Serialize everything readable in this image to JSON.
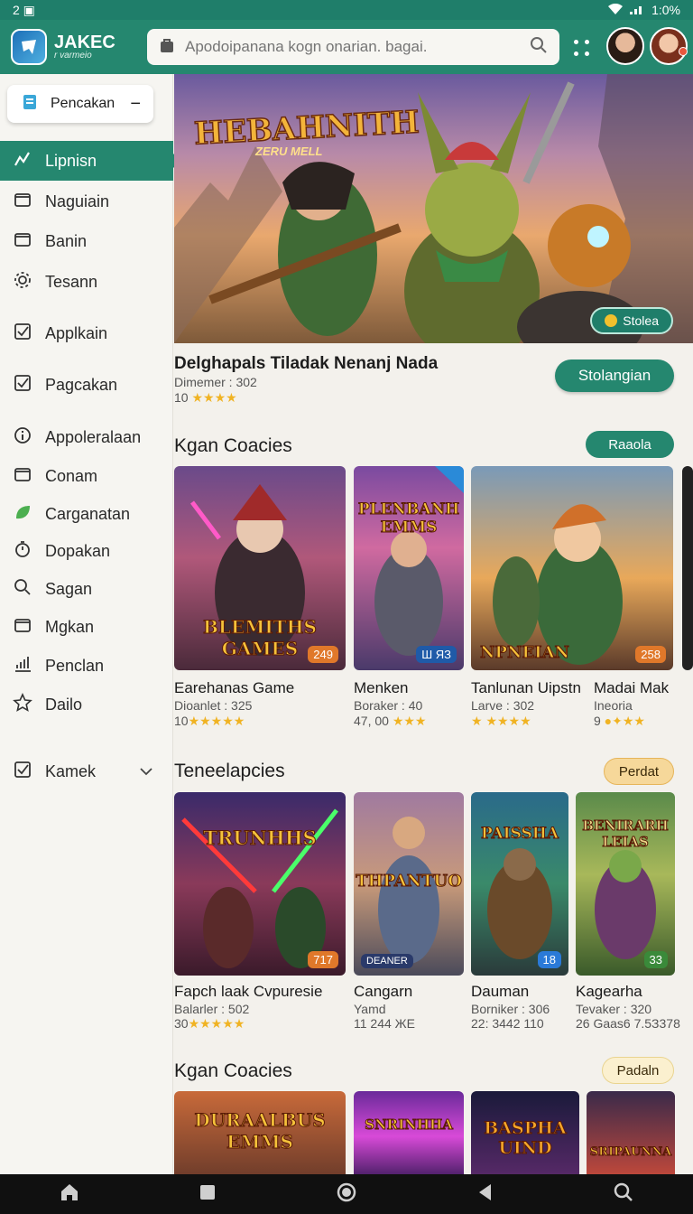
{
  "status": {
    "left": "2 ▣",
    "right": "1:0%"
  },
  "app": {
    "logo_title": "JAKEC",
    "logo_sub": "r varmeio"
  },
  "search": {
    "placeholder": "Apodoipanana kogn onarian. bagai."
  },
  "sidebar": {
    "top_button": "Pencakan",
    "items": [
      {
        "label": "Lipnisn",
        "icon": "chart-icon",
        "active": true
      },
      {
        "label": "Naguiain",
        "icon": "folder-icon"
      },
      {
        "label": "Banin",
        "icon": "folder-icon"
      },
      {
        "label": "Tesann",
        "icon": "gear-icon"
      },
      {
        "label": "Applkain",
        "icon": "check-icon"
      },
      {
        "label": "Pagcakan",
        "icon": "check-icon"
      },
      {
        "label": "Appoleralaan",
        "icon": "info-icon"
      },
      {
        "label": "Conam",
        "icon": "folder-icon"
      },
      {
        "label": "Carganatan",
        "icon": "leaf-icon"
      },
      {
        "label": "Dopakan",
        "icon": "timer-icon"
      },
      {
        "label": "Sagan",
        "icon": "search-icon"
      },
      {
        "label": "Mgkan",
        "icon": "folder-icon"
      },
      {
        "label": "Penclan",
        "icon": "bar-chart-icon"
      },
      {
        "label": "Dailo",
        "icon": "star-icon"
      },
      {
        "label": "Kamek",
        "icon": "check-icon"
      }
    ]
  },
  "hero": {
    "title": "HEBAHNITH",
    "subtitle": "ZERU MELL",
    "pill": "Stolea",
    "feature_title": "Delghapals Tiladak Nenanj Nada",
    "feature_meta": "Dimemer : 302",
    "feature_rating": "10",
    "feature_button": "Stolangian"
  },
  "sections": [
    {
      "title": "Kgan Coacies",
      "button": "Raaola",
      "cards": [
        {
          "art_label": "BLEMITHS GAMES",
          "tag": "249",
          "title": "Earehanas Game",
          "meta": "Dioanlet : 325",
          "rating": "10"
        },
        {
          "art_label": "PLENBANH EMMS",
          "tag": "Ш ЯЗ",
          "title": "Menken",
          "meta": "Boraker : 40",
          "rating": "47, 00"
        },
        {
          "art_label": "NPNEIAN",
          "tag": "258",
          "title": "Tanlunan Uipstn",
          "meta": "Larve : 302",
          "rating": ""
        },
        {
          "art_label": "",
          "tag": "",
          "title": "Madai Mak",
          "meta": "Ineoria",
          "rating": "9"
        }
      ]
    },
    {
      "title": "Teneelapcies",
      "button": "Perdat",
      "cards": [
        {
          "art_label": "TRUNHHS",
          "tag": "717",
          "title": "Fapch laak Cvpuresie",
          "meta": "Balarler : 502",
          "rating": "30"
        },
        {
          "art_label": "THPANTUO",
          "tag": "DEANER",
          "title": "Cangarn",
          "meta": "Yamd",
          "rating": "11  244  ЖЕ"
        },
        {
          "art_label": "PAISSHA",
          "tag": "18",
          "title": "Dauman",
          "meta": "Borniker : 306",
          "rating": "22: 3442 110"
        },
        {
          "art_label": "BENIRARH LEIAS",
          "tag": "33",
          "title": "Kagearha",
          "meta": "Tevaker : 320",
          "rating": "26 Gaas6  7.5З378"
        }
      ]
    },
    {
      "title": "Kgan Coacies",
      "button": "Padaln",
      "cards": [
        {
          "art_label": "DURAALBUS EMMS"
        },
        {
          "art_label": "SNRINHHA"
        },
        {
          "art_label": "BASPHA UIND"
        },
        {
          "art_label": "SRIPAUNNA"
        }
      ]
    }
  ],
  "navbar": {
    "items": [
      "home-icon",
      "square-icon",
      "circle-icon",
      "back-icon",
      "search-icon"
    ]
  },
  "colors": {
    "primary": "#25876f",
    "accent": "#f0b323",
    "background": "#f3f1ec"
  }
}
